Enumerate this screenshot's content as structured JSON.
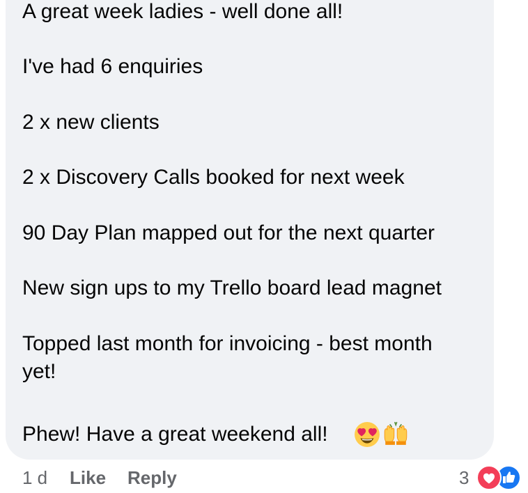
{
  "comment": {
    "lines": [
      "A great week ladies - well done all!",
      "I've had 6 enquiries",
      "2 x new clients",
      "2 x Discovery Calls booked for next week",
      "90 Day Plan mapped out for the next quarter",
      "New sign ups to my Trello board lead magnet",
      "Topped last month for invoicing - best month",
      "yet!",
      "Phew! Have a great weekend all!"
    ],
    "emojis": [
      "heart-eyes-emoji",
      "raising-hands-emoji"
    ]
  },
  "footer": {
    "time": "1 d",
    "like_label": "Like",
    "reply_label": "Reply",
    "reaction_count": "3",
    "reactions": [
      "love-reaction-icon",
      "like-reaction-icon"
    ]
  },
  "colors": {
    "bubble_bg": "#f0f2f5",
    "text": "#050505",
    "meta": "#65676b",
    "love": "#f33e58",
    "like": "#1877f2"
  }
}
